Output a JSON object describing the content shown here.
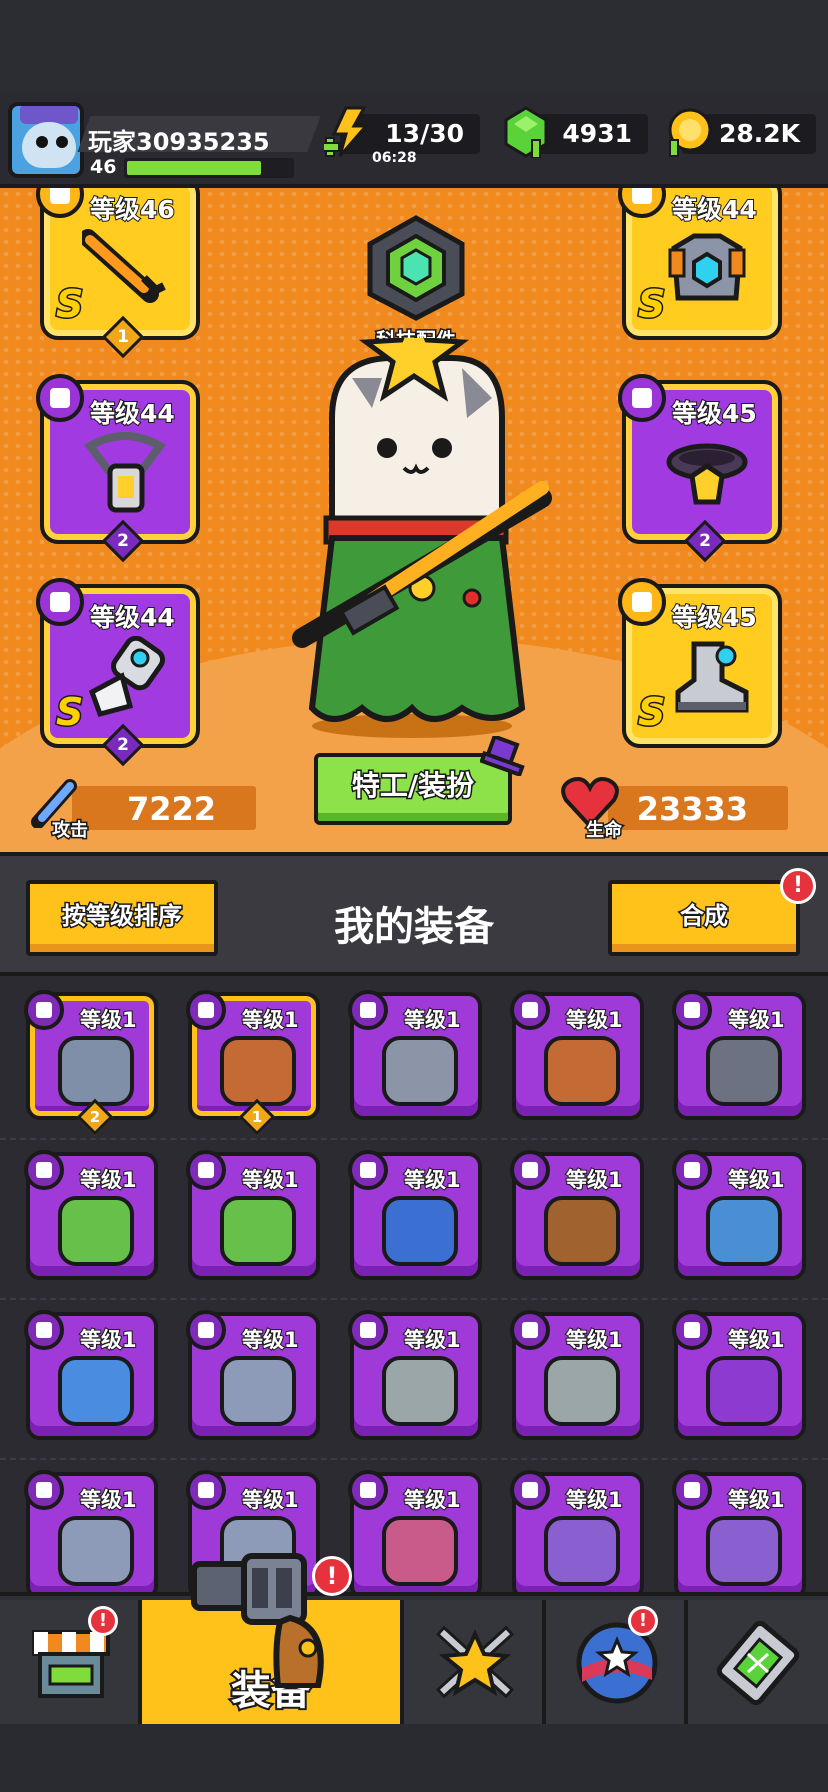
{
  "player": {
    "name": "玩家30935235",
    "level": "46",
    "xp_fraction": 0.82
  },
  "resources": {
    "energy": "13/30",
    "energy_timer": "06:28",
    "gems": "4931",
    "coins": "28.2K"
  },
  "tech": {
    "label": "科技配件"
  },
  "equipped": [
    {
      "level": "等级46",
      "rank": "S",
      "count": "1",
      "rarity": "gold",
      "icon": "sword-icon"
    },
    {
      "level": "等级44",
      "rank": "S",
      "count": "",
      "rarity": "gold",
      "icon": "armor-icon"
    },
    {
      "level": "等级44",
      "rank": "",
      "count": "2",
      "rarity": "purple",
      "icon": "lantern-necklace-icon"
    },
    {
      "level": "等级45",
      "rank": "",
      "count": "2",
      "rarity": "purple",
      "icon": "belt-icon"
    },
    {
      "level": "等级44",
      "rank": "S",
      "count": "2",
      "rarity": "purple",
      "icon": "gauntlet-icon"
    },
    {
      "level": "等级45",
      "rank": "S",
      "count": "",
      "rarity": "gold",
      "icon": "boot-icon"
    }
  ],
  "stats": {
    "attack_label": "攻击",
    "attack": "7222",
    "hp_label": "生命",
    "hp": "23333"
  },
  "agent_button": "特工/装扮",
  "equipment": {
    "sort_button": "按等级排序",
    "title": "我的装备",
    "merge_button": "合成",
    "items": [
      {
        "level": "等级1",
        "count": "2",
        "icon": "boot-icon",
        "color": "#7f8fa8"
      },
      {
        "level": "等级1",
        "count": "1",
        "icon": "fang-necklace-icon",
        "color": "#c46a35"
      },
      {
        "level": "等级1",
        "count": "",
        "icon": "armor-icon",
        "color": "#8c94a8"
      },
      {
        "level": "等级1",
        "count": "",
        "icon": "fang-necklace-icon",
        "color": "#c46a35"
      },
      {
        "level": "等级1",
        "count": "",
        "icon": "spiked-collar-icon",
        "color": "#6d7282"
      },
      {
        "level": "等级1",
        "count": "",
        "icon": "gem-necklace-icon",
        "color": "#67c04a"
      },
      {
        "level": "等级1",
        "count": "",
        "icon": "gem-necklace-icon",
        "color": "#67c04a"
      },
      {
        "level": "等级1",
        "count": "",
        "icon": "shield-necklace-icon",
        "color": "#3b6fd1"
      },
      {
        "level": "等级1",
        "count": "",
        "icon": "rope-belt-icon",
        "color": "#a0622e"
      },
      {
        "level": "等级1",
        "count": "",
        "icon": "star-belt-icon",
        "color": "#4a8fd6"
      },
      {
        "level": "等级1",
        "count": "",
        "icon": "claw-glove-icon",
        "color": "#4a8de0"
      },
      {
        "level": "等级1",
        "count": "",
        "icon": "metal-glove-icon",
        "color": "#8d9ab8"
      },
      {
        "level": "等级1",
        "count": "",
        "icon": "metal-glove-icon",
        "color": "#9aa6a8"
      },
      {
        "level": "等级1",
        "count": "",
        "icon": "metal-glove-icon",
        "color": "#9aa6a8"
      },
      {
        "level": "等级1",
        "count": "",
        "icon": "purple-glove-icon",
        "color": "#8d3ad1"
      },
      {
        "level": "等级1",
        "count": "",
        "icon": "metal-glove-icon",
        "color": "#8d9ab8"
      },
      {
        "level": "等级1",
        "count": "",
        "icon": "metal-glove-icon",
        "color": "#8d9ab8"
      },
      {
        "level": "等级1",
        "count": "",
        "icon": "spiked-boot-icon",
        "color": "#c85b8a"
      },
      {
        "level": "等级1",
        "count": "",
        "icon": "sneaker-icon",
        "color": "#8a5fd0"
      },
      {
        "level": "等级1",
        "count": "",
        "icon": "sneaker-icon",
        "color": "#8a5fd0"
      }
    ]
  },
  "nav": {
    "shop_icon": "shop-icon",
    "equip_label": "装备",
    "battle_icon": "crossed-swords-star-icon",
    "talent_icon": "star-orb-icon",
    "dna_icon": "dna-capsule-icon"
  },
  "colors": {
    "hero_bg": "#f08a1e",
    "gold_frame": "#ffcc1f",
    "purple_frame": "#a13ae0",
    "alert": "#e6323c",
    "xp": "#7fdc3b"
  }
}
